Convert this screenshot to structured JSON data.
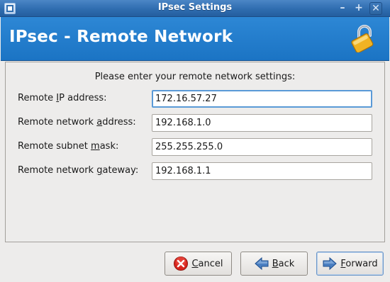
{
  "window": {
    "title": "IPsec Settings",
    "controls": {
      "minimize": "–",
      "maximize": "+",
      "close": "✕"
    }
  },
  "header": {
    "title": "IPsec - Remote Network",
    "icon": "lock-icon"
  },
  "form": {
    "instructions": "Please enter your remote network settings:",
    "fields": [
      {
        "label_pre": "Remote ",
        "label_mn": "I",
        "label_post": "P address:",
        "value": "172.16.57.27"
      },
      {
        "label_pre": "Remote network ",
        "label_mn": "a",
        "label_post": "ddress:",
        "value": "192.168.1.0"
      },
      {
        "label_pre": "Remote subnet ",
        "label_mn": "m",
        "label_post": "ask:",
        "value": "255.255.255.0"
      },
      {
        "label_pre": "Remote network ",
        "label_mn": "g",
        "label_post": "ateway:",
        "value": "192.168.1.1"
      }
    ]
  },
  "buttons": {
    "cancel": {
      "mn": "C",
      "rest": "ancel",
      "icon": "cancel-icon",
      "color": "#d8251d"
    },
    "back": {
      "mn": "B",
      "rest": "ack",
      "icon": "back-arrow-icon",
      "color": "#3a6fb5"
    },
    "forward": {
      "mn": "F",
      "rest": "orward",
      "icon": "forward-arrow-icon",
      "color": "#3a6fb5"
    }
  },
  "colors": {
    "titlebar": "#2f6db0",
    "banner": "#2280cf",
    "window_bg": "#edeceb",
    "focus_ring": "#5a9ad7"
  }
}
